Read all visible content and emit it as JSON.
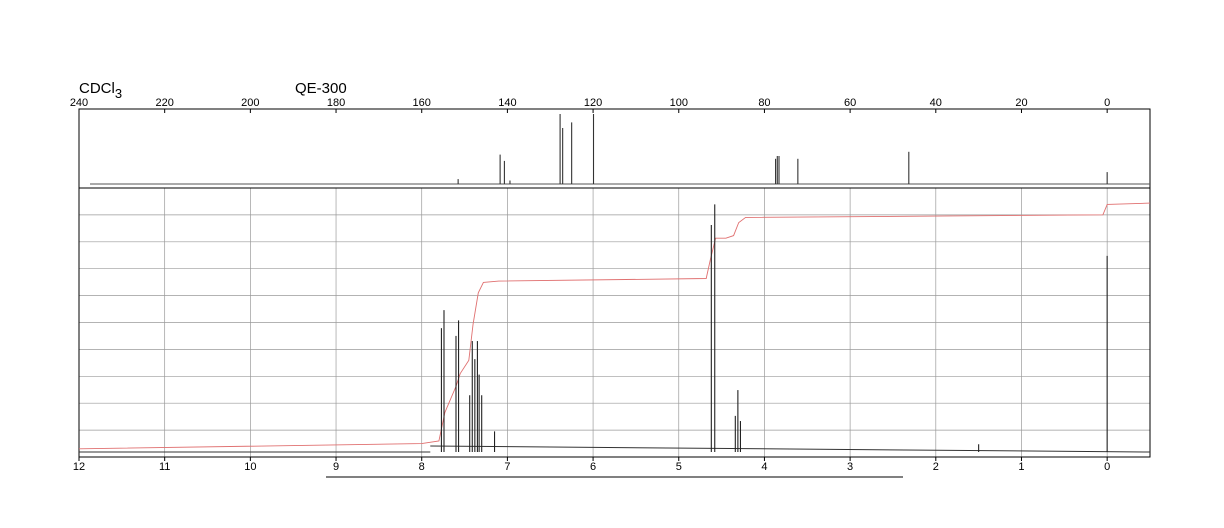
{
  "header": {
    "solvent_main": "CDCl",
    "solvent_sub": "3",
    "instrument": "QE-300"
  },
  "chart_data": [
    {
      "type": "line",
      "name": "13C",
      "xlim": [
        240,
        -10
      ],
      "x_ticks": [
        "240",
        "220",
        "200",
        "180",
        "160",
        "140",
        "120",
        "100",
        "80",
        "60",
        "40",
        "20",
        "0"
      ],
      "grid": false,
      "peaks": [
        {
          "x": 151.5,
          "y": 0.07
        },
        {
          "x": 141.7,
          "y": 0.42
        },
        {
          "x": 140.7,
          "y": 0.33
        },
        {
          "x": 139.4,
          "y": 0.05
        },
        {
          "x": 127.7,
          "y": 1.0
        },
        {
          "x": 127.1,
          "y": 0.8
        },
        {
          "x": 125.0,
          "y": 0.88
        },
        {
          "x": 119.9,
          "y": 1.0
        },
        {
          "x": 77.4,
          "y": 0.36
        },
        {
          "x": 77.0,
          "y": 0.4
        },
        {
          "x": 76.6,
          "y": 0.4
        },
        {
          "x": 72.2,
          "y": 0.36
        },
        {
          "x": 46.3,
          "y": 0.46
        },
        {
          "x": 0.0,
          "y": 0.17
        }
      ]
    },
    {
      "type": "line",
      "name": "1H",
      "xlim": [
        12,
        -0.5
      ],
      "x_ticks": [
        "12",
        "11",
        "10",
        "9",
        "8",
        "7",
        "6",
        "5",
        "4",
        "3",
        "2",
        "1",
        "0"
      ],
      "grid": true,
      "peaks": [
        {
          "x": 7.77,
          "y": 0.48
        },
        {
          "x": 7.74,
          "y": 0.55
        },
        {
          "x": 7.6,
          "y": 0.45
        },
        {
          "x": 7.57,
          "y": 0.51
        },
        {
          "x": 7.44,
          "y": 0.22
        },
        {
          "x": 7.41,
          "y": 0.43
        },
        {
          "x": 7.38,
          "y": 0.36
        },
        {
          "x": 7.35,
          "y": 0.43
        },
        {
          "x": 7.33,
          "y": 0.3
        },
        {
          "x": 7.3,
          "y": 0.22
        },
        {
          "x": 7.15,
          "y": 0.08
        },
        {
          "x": 4.62,
          "y": 0.88
        },
        {
          "x": 4.58,
          "y": 0.96
        },
        {
          "x": 4.34,
          "y": 0.14
        },
        {
          "x": 4.31,
          "y": 0.24
        },
        {
          "x": 4.28,
          "y": 0.12
        },
        {
          "x": 1.5,
          "y": 0.03
        },
        {
          "x": 0.0,
          "y": 0.76
        }
      ],
      "integral": [
        {
          "x": 12.0,
          "y": 0.02
        },
        {
          "x": 8.0,
          "y": 0.04
        },
        {
          "x": 7.8,
          "y": 0.05
        },
        {
          "x": 7.73,
          "y": 0.16
        },
        {
          "x": 7.6,
          "y": 0.26
        },
        {
          "x": 7.55,
          "y": 0.31
        },
        {
          "x": 7.45,
          "y": 0.36
        },
        {
          "x": 7.4,
          "y": 0.5
        },
        {
          "x": 7.34,
          "y": 0.62
        },
        {
          "x": 7.28,
          "y": 0.66
        },
        {
          "x": 7.1,
          "y": 0.665
        },
        {
          "x": 4.68,
          "y": 0.675
        },
        {
          "x": 4.63,
          "y": 0.75
        },
        {
          "x": 4.57,
          "y": 0.83
        },
        {
          "x": 4.45,
          "y": 0.83
        },
        {
          "x": 4.36,
          "y": 0.84
        },
        {
          "x": 4.3,
          "y": 0.89
        },
        {
          "x": 4.22,
          "y": 0.91
        },
        {
          "x": 2.0,
          "y": 0.915
        },
        {
          "x": 0.05,
          "y": 0.92
        },
        {
          "x": 0.0,
          "y": 0.96
        },
        {
          "x": -0.5,
          "y": 0.965
        }
      ]
    }
  ]
}
